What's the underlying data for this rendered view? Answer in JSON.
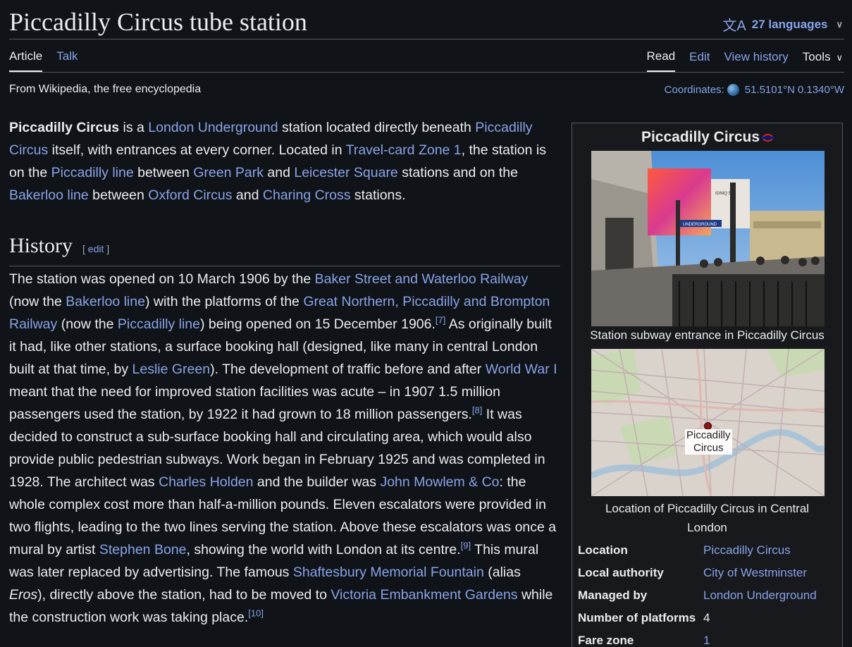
{
  "header": {
    "title": "Piccadilly Circus tube station",
    "languages_label": "27 languages",
    "tabs_left": [
      "Article",
      "Talk"
    ],
    "tabs_right": [
      "Read",
      "Edit",
      "View history"
    ],
    "tools_label": "Tools"
  },
  "tagline": "From Wikipedia, the free encyclopedia",
  "coordinates": {
    "label": "Coordinates:",
    "value": "51.5101°N 0.1340°W"
  },
  "intro": {
    "bold": "Piccadilly Circus",
    "t1": " is a ",
    "l1": "London Underground",
    "t2": " station located directly beneath ",
    "l2": "Piccadilly Circus",
    "t3": " itself, with entrances at every corner. Located in ",
    "l3": "Travel-card Zone 1",
    "t4": ", the station is on the ",
    "l4": "Piccadilly line",
    "t5": " between ",
    "l5": "Green Park",
    "t6": " and ",
    "l6": "Leicester Square",
    "t7": " stations and on the ",
    "l7": "Bakerloo line",
    "t8": " between ",
    "l8": "Oxford Circus",
    "t9": " and ",
    "l9": "Charing Cross",
    "t10": " stations."
  },
  "history": {
    "heading": "History",
    "edit_open": "[ ",
    "edit_label": "edit",
    "edit_close": " ]",
    "t1": "The station was opened on 10 March 1906 by the ",
    "l1": "Baker Street and Waterloo Railway",
    "t2": " (now the ",
    "l2": "Bakerloo line",
    "t3": ") with the platforms of the ",
    "l3": "Great Northern, Piccadilly and Brompton Railway",
    "t4": " (now the ",
    "l4": "Piccadilly line",
    "t5": ") being opened on 15 December 1906.",
    "ref7": "[7]",
    "t6": " As originally built it had, like other stations, a surface booking hall (designed, like many in central London built at that time, by ",
    "l5": "Leslie Green",
    "t7": "). The development of traffic before and after ",
    "l6": "World War I",
    "t8": " meant that the need for improved station facilities was acute – in 1907 1.5 million passengers used the station, by 1922 it had grown to 18 million passengers.",
    "ref8": "[8]",
    "t9": " It was decided to construct a sub-surface booking hall and circulating area, which would also provide public pedestrian subways. Work began in February 1925 and was completed in 1928. The architect was ",
    "l7": "Charles Holden",
    "t10": " and the builder was ",
    "l8": "John Mowlem & Co",
    "t11": ": the whole complex cost more than half-a-million pounds. Eleven escalators were provided in two flights, leading to the two lines serving the station. Above these escalators was once a mural by artist ",
    "l9": "Stephen Bone",
    "t12": ", showing the world with London at its centre.",
    "ref9": "[9]",
    "t13": " This mural was later replaced by advertising. The famous ",
    "l10": "Shaftesbury Memorial Fountain",
    "t14": " (alias ",
    "em1": "Eros",
    "t15": "), directly above the station, had to be moved to ",
    "l11": "Victoria Embankment Gardens",
    "t16": " while the construction work was taking place.",
    "ref10": "[10]"
  },
  "infobox": {
    "title": "Piccadilly Circus",
    "photo_caption": "Station subway entrance in Piccadilly Circus",
    "photo_sign1": "IONIQ 5",
    "photo_sign2": "UNDERGROUND",
    "map_label_1": "Piccadilly",
    "map_label_2": "Circus",
    "map_caption": "Location of Piccadilly Circus in Central London",
    "rows": [
      {
        "key": "Location",
        "value": "Piccadilly Circus"
      },
      {
        "key": "Local authority",
        "value": "City of Westminster"
      },
      {
        "key": "Managed by",
        "value": "London Underground"
      },
      {
        "key": "Number of platforms",
        "value": "4"
      },
      {
        "key": "Fare zone",
        "value": "1"
      }
    ]
  },
  "colors": {
    "background": "#101418",
    "link": "#88a3e8",
    "text": "#eaecf0"
  }
}
